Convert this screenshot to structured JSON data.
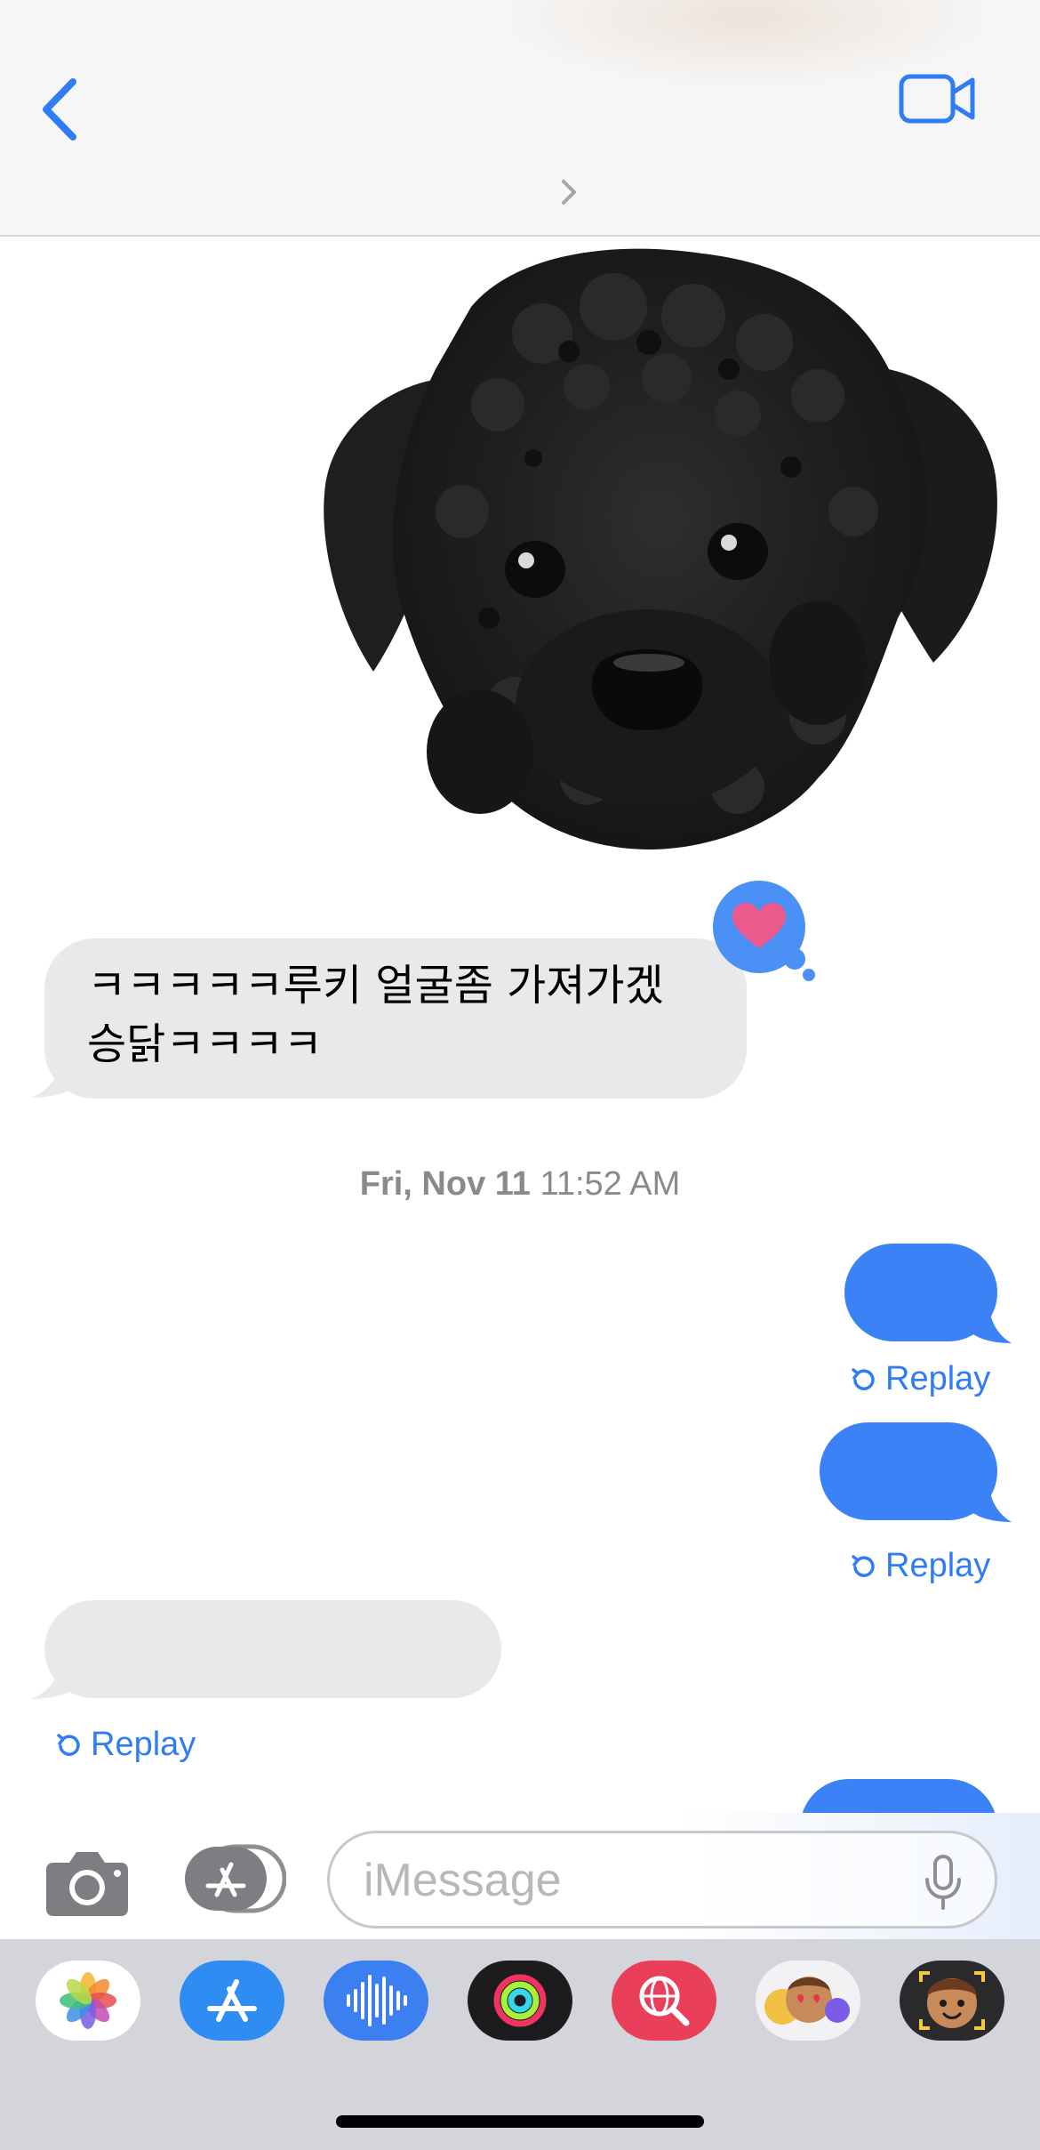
{
  "conversation": {
    "received_message": "ㅋㅋㅋㅋㅋ루키 얼굴좀 가져가겠\n승닭ㅋㅋㅋㅋ",
    "timestamp_day": "Fri, Nov 11",
    "timestamp_time": "11:52 AM",
    "replay_label": "Replay"
  },
  "input": {
    "placeholder": "iMessage"
  },
  "colors": {
    "accent": "#2f7cf6",
    "sent_bubble": "#3b82f6",
    "received_bubble": "#e9e9eb",
    "tapback_heart": "#ec5a8d"
  },
  "icons": {
    "back": "chevron-left-icon",
    "facetime": "video-camera-icon",
    "camera": "camera-icon",
    "apps": "app-store-icon",
    "mic": "microphone-icon",
    "replay": "replay-icon"
  },
  "app_drawer": [
    "photos",
    "app-store",
    "audio-message",
    "activity",
    "image-search",
    "animoji",
    "memoji"
  ]
}
